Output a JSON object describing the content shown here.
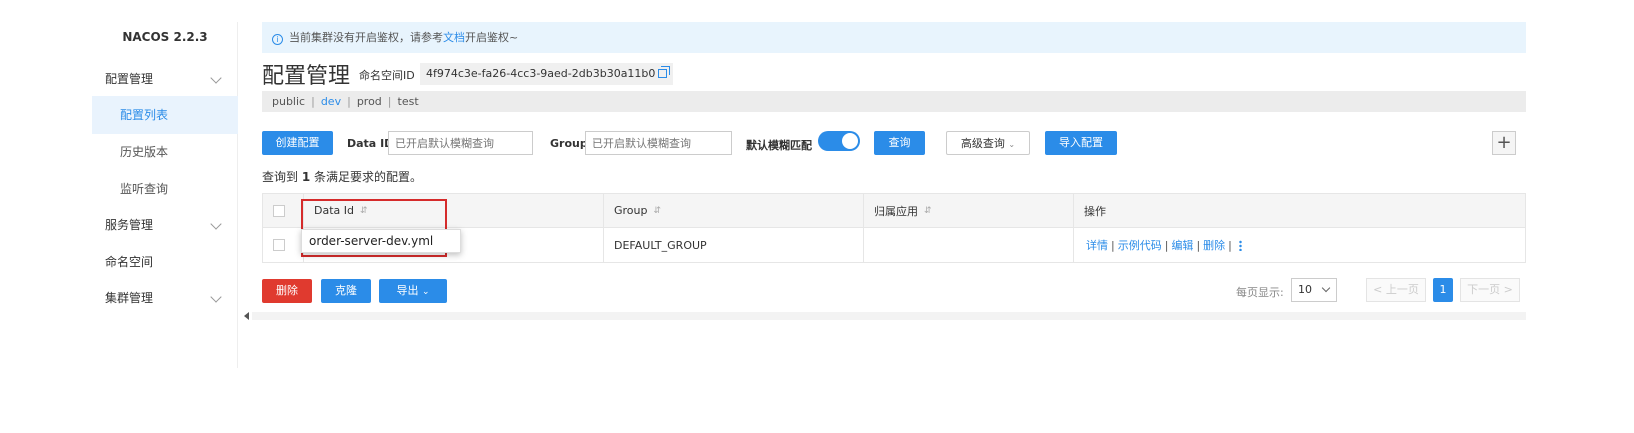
{
  "app": {
    "brand": "NACOS 2.2.3"
  },
  "sidebar": {
    "items": [
      {
        "label": "配置管理",
        "expandable": true
      },
      {
        "label": "配置列表",
        "sub": true,
        "active": true
      },
      {
        "label": "历史版本",
        "sub": true
      },
      {
        "label": "监听查询",
        "sub": true
      },
      {
        "label": "服务管理",
        "expandable": true
      },
      {
        "label": "命名空间"
      },
      {
        "label": "集群管理",
        "expandable": true
      }
    ]
  },
  "notice": {
    "text": "当前集群没有开启鉴权，请参考",
    "link": "文档",
    "suffix": "开启鉴权~"
  },
  "header": {
    "title": "配置管理",
    "ns_label": "命名空间ID",
    "ns_id": "4f974c3e-fa26-4cc3-9aed-2db3b30a11b0"
  },
  "namespaces": {
    "items": [
      "public",
      "dev",
      "prod",
      "test"
    ],
    "current": "dev"
  },
  "search": {
    "create_label": "创建配置",
    "dataid_label": "Data ID",
    "dataid_placeholder": "已开启默认模糊查询",
    "group_label": "Group",
    "group_placeholder": "已开启默认模糊查询",
    "fuzzy_label": "默认模糊匹配",
    "fuzzy_on": true,
    "query_label": "查询",
    "advanced_label": "高级查询",
    "import_label": "导入配置",
    "plus_label": "+"
  },
  "result": {
    "prefix": "查询到",
    "count": "1",
    "suffix": "条满足要求的配置。"
  },
  "table": {
    "columns": [
      "Data Id",
      "Group",
      "归属应用",
      "操作"
    ],
    "rows": [
      {
        "data_id": "order-server-dev.yml",
        "group": "DEFAULT_GROUP",
        "app": ""
      }
    ],
    "ops": [
      "详情",
      "示例代码",
      "编辑",
      "删除"
    ]
  },
  "tooltip": {
    "text": "order-server-dev.yml"
  },
  "bottom_actions": {
    "delete_label": "删除",
    "clone_label": "克隆",
    "export_label": "导出"
  },
  "pagination": {
    "size_label": "每页显示:",
    "page_size": "10",
    "prev_label": "< 上一页",
    "current_page": "1",
    "next_label": "下一页 >"
  },
  "colors": {
    "primary": "#2b8ce8",
    "danger": "#e03a2f",
    "highlight": "#d52b2b"
  }
}
